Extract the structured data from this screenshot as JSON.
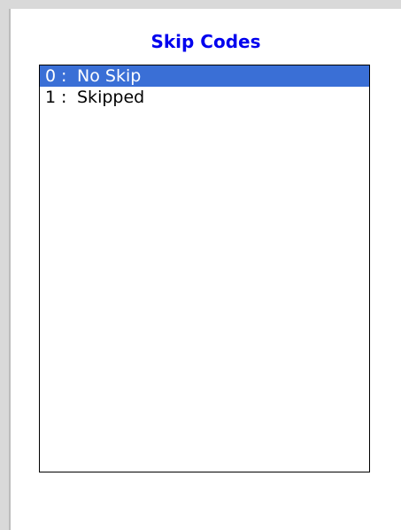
{
  "screen": {
    "title": "Skip Codes"
  },
  "skip_codes": {
    "items": [
      {
        "code": "0",
        "separator": ":",
        "label": "No Skip",
        "selected": true
      },
      {
        "code": "1",
        "separator": ":",
        "label": "Skipped",
        "selected": false
      }
    ]
  },
  "colors": {
    "title": "#0000ee",
    "selection": "#3a6fd6",
    "frame": "#d9d9d9"
  }
}
